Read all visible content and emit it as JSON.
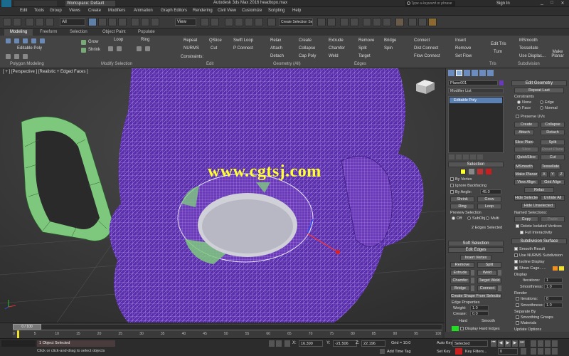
{
  "app": {
    "window_title": "Autodesk 3ds Max 2016    headtopo.max",
    "workspace": "Workspace: Default",
    "search_placeholder": "Type a keyword or phrase",
    "sign_in": "Sign In"
  },
  "menus": [
    "Edit",
    "Tools",
    "Group",
    "Views",
    "Create",
    "Modifiers",
    "Animation",
    "Graph Editors",
    "Rendering",
    "Civil View",
    "Customize",
    "Scripting",
    "Help"
  ],
  "toolbar": {
    "selection_filter": "All",
    "view_dropdown": "View",
    "create_selection_set": "Create Selection Se"
  },
  "ribbon_tabs": [
    "Modeling",
    "Freeform",
    "Selection",
    "Object Paint",
    "Populate"
  ],
  "ribbon": {
    "object_type": "Editable Poly",
    "polygon_modeling": "Polygon Modeling",
    "modify_selection": "Modify Selection",
    "edit_section": "Edit",
    "geometry_section": "Geometry (All)",
    "edges_section": "Edges",
    "tris_section": "Tris",
    "subdivision_section": "Subdivision",
    "grow": "Grow",
    "shrink": "Shrink",
    "loop": "Loop",
    "ring": "Ring",
    "repeat": "Repeat",
    "qslice": "QSlice",
    "swiftloop": "Swift Loop",
    "nurms": "NURMS",
    "cut": "Cut",
    "pconnect": "P Connect",
    "constraints": "Constraints:",
    "relax": "Relax",
    "create": "Create",
    "attach": "Attach",
    "collapse": "Collapse",
    "detach": "Detach",
    "cap_poly": "Cap Poly",
    "extrude": "Extrude",
    "remove": "Remove",
    "bridge": "Bridge",
    "chamfer": "Chamfer",
    "split": "Split",
    "spin": "Spin",
    "weld": "Weld",
    "target": "Target",
    "connect": "Connect",
    "insert": "Insert",
    "dist_connect": "Dist Connect",
    "remove2": "Remove",
    "flow_connect": "Flow Connect",
    "set_flow": "Set Flow",
    "edit_tris": "Edit Tris",
    "turn": "Turn",
    "msmooth": "MSmooth",
    "tessellate": "Tessellate",
    "use_displace": "Use Displac...",
    "make_planar": "Make Planar"
  },
  "viewport": {
    "label": "[ + ] [Perspective ] [Realistic + Edged Faces ]",
    "watermark": "www.cgtsj.com"
  },
  "command_panel": {
    "object_name": "Plane001",
    "modifier_list": "Modifier List",
    "stack_item": "Editable Poly",
    "edit_geometry": {
      "header": "Edit Geometry",
      "repeat_last": "Repeat Last",
      "constraints": "Constraints",
      "none": "None",
      "edge": "Edge",
      "face": "Face",
      "normal": "Normal",
      "preserve_uvs": "Preserve UVs",
      "create": "Create",
      "collapse": "Collapse",
      "attach": "Attach",
      "detach": "Detach",
      "slice_plane": "Slice Plane",
      "split": "Split",
      "slice": "Slice",
      "reset_plane": "Reset Plane",
      "quickslice": "QuickSlice",
      "cut": "Cut",
      "msmooth": "MSmooth",
      "tessellate": "Tessellate",
      "make_planar": "Make Planar",
      "x": "X",
      "y": "Y",
      "z": "Z",
      "view_align": "View Align",
      "grid_align": "Grid Align",
      "relax": "Relax",
      "hide_selected": "Hide Selected",
      "unhide_all": "Unhide All",
      "hide_unselected": "Hide Unselected",
      "named_selections": "Named Selections:",
      "copy": "Copy",
      "paste": "Paste",
      "delete_isolated": "Delete Isolated Vertices",
      "full_interactivity": "Full Interactivity"
    },
    "selection": {
      "header": "Selection",
      "by_vertex": "By Vertex",
      "ignore_backfacing": "Ignore Backfacing",
      "by_angle": "By Angle:",
      "angle_value": "45.0",
      "shrink": "Shrink",
      "grow": "Grow",
      "ring": "Ring",
      "loop": "Loop",
      "preview_selection": "Preview Selection",
      "off": "Off",
      "subobj": "SubObj",
      "multi": "Multi",
      "status": "2 Edges Selected"
    },
    "soft_selection": {
      "header": "Soft Selection"
    },
    "edit_edges": {
      "header": "Edit Edges",
      "insert_vertex": "Insert Vertex",
      "remove": "Remove",
      "split": "Split",
      "extrude": "Extrude",
      "weld": "Weld",
      "chamfer": "Chamfer",
      "target_weld": "Target Weld",
      "bridge": "Bridge",
      "connect": "Connect",
      "create_shape": "Create Shape From Selection",
      "edge_properties": "Edge Properties",
      "weight_label": "Weight:",
      "weight_value": "1.0",
      "crease_label": "Crease:",
      "crease_value": "0.0",
      "hard": "Hard",
      "smooth": "Smooth",
      "display_hard_edges": "Display Hard Edges"
    },
    "subdivision_surface": {
      "header": "Subdivision Surface",
      "smooth_result": "Smooth Result",
      "use_nurms": "Use NURMS Subdivision",
      "isoline_display": "Isoline Display",
      "show_cage": "Show Cage......",
      "display": "Display",
      "iterations_label": "Iterations:",
      "iterations_value": "1",
      "smoothness_label": "Smoothness:",
      "smoothness_value": "1.0",
      "render": "Render",
      "render_iterations_value": "0",
      "render_smoothness_value": "1.0",
      "separate_by": "Separate By",
      "smoothing_groups": "Smoothing Groups",
      "materials": "Materials",
      "update_options": "Update Options"
    }
  },
  "timeline": {
    "frame_display": "0 / 100",
    "ticks": [
      "0",
      "5",
      "10",
      "15",
      "20",
      "25",
      "30",
      "35",
      "40",
      "45",
      "50",
      "55",
      "60",
      "65",
      "70",
      "75",
      "80",
      "85",
      "90",
      "95",
      "100"
    ],
    "progress": 0.0
  },
  "status": {
    "objects_selected": "1 Object Selected",
    "prompt": "Click or click-and-drag to select objects",
    "x_label": "X:",
    "x_value": "16.399",
    "y_label": "Y:",
    "y_value": "-21.506",
    "z_label": "Z:",
    "z_value": "22.196",
    "grid": "Grid = 10.0",
    "add_time_tag": "Add Time Tag",
    "auto_key": "Auto Key",
    "selected": "Selected",
    "set_key": "Set Key",
    "key_filters": "Key Filters...",
    "frame_value": "0"
  },
  "colors": {
    "accent_yellow": "#ffff33",
    "mesh_purple": "#6a3ab8",
    "selection_green": "#7ec87e",
    "key_red": "#c81e1e"
  }
}
